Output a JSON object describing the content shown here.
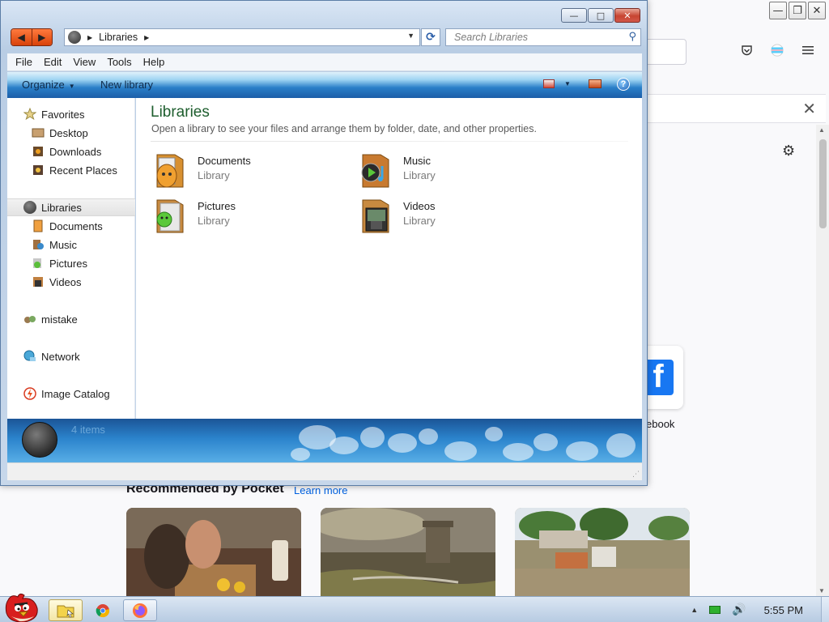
{
  "firefox": {
    "controls": {
      "minimize": "—",
      "maximize": "❐",
      "close": "✕"
    },
    "toolbar_icons": [
      "pocket-icon",
      "account-icon",
      "menu-icon"
    ],
    "search_close": "✕",
    "settings_icon": "gear-icon",
    "topsite": {
      "label": "ebook",
      "logo_letter": "f",
      "brand_color": "#1877f2"
    },
    "pocket": {
      "title": "Recommended by Pocket",
      "learn_more": "Learn more",
      "cards": [
        {
          "name": "cooking-photo"
        },
        {
          "name": "castle-photo"
        },
        {
          "name": "flood-photo"
        }
      ]
    }
  },
  "explorer": {
    "caption_buttons": {
      "minimize": "—",
      "maximize": "□",
      "close": "✕"
    },
    "nav": {
      "back": "◀",
      "forward": "▶"
    },
    "address": {
      "crumb": "Libraries",
      "separator": "▶"
    },
    "search": {
      "placeholder": "Search Libraries",
      "value": ""
    },
    "menu": [
      "File",
      "Edit",
      "View",
      "Tools",
      "Help"
    ],
    "commands": {
      "organize": "Organize",
      "new_library": "New library",
      "help": "?"
    },
    "nav_pane": {
      "favorites": {
        "label": "Favorites",
        "items": [
          "Desktop",
          "Downloads",
          "Recent Places"
        ]
      },
      "libraries": {
        "label": "Libraries",
        "items": [
          "Documents",
          "Music",
          "Pictures",
          "Videos"
        ]
      },
      "homegroup": {
        "label": "mistake"
      },
      "network": {
        "label": "Network"
      },
      "catalog": {
        "label": "Image Catalog"
      }
    },
    "content": {
      "title": "Libraries",
      "description": "Open a library to see your files and arrange them by folder, date, and other properties.",
      "libraries": [
        {
          "name": "Documents",
          "type": "Library"
        },
        {
          "name": "Music",
          "type": "Library"
        },
        {
          "name": "Pictures",
          "type": "Library"
        },
        {
          "name": "Videos",
          "type": "Library"
        }
      ]
    },
    "details": {
      "count": "4 items"
    }
  },
  "taskbar": {
    "items": [
      "explorer-taskbar-button",
      "chrome-taskbar-button",
      "firefox-taskbar-button"
    ],
    "clock": "5:55 PM"
  }
}
